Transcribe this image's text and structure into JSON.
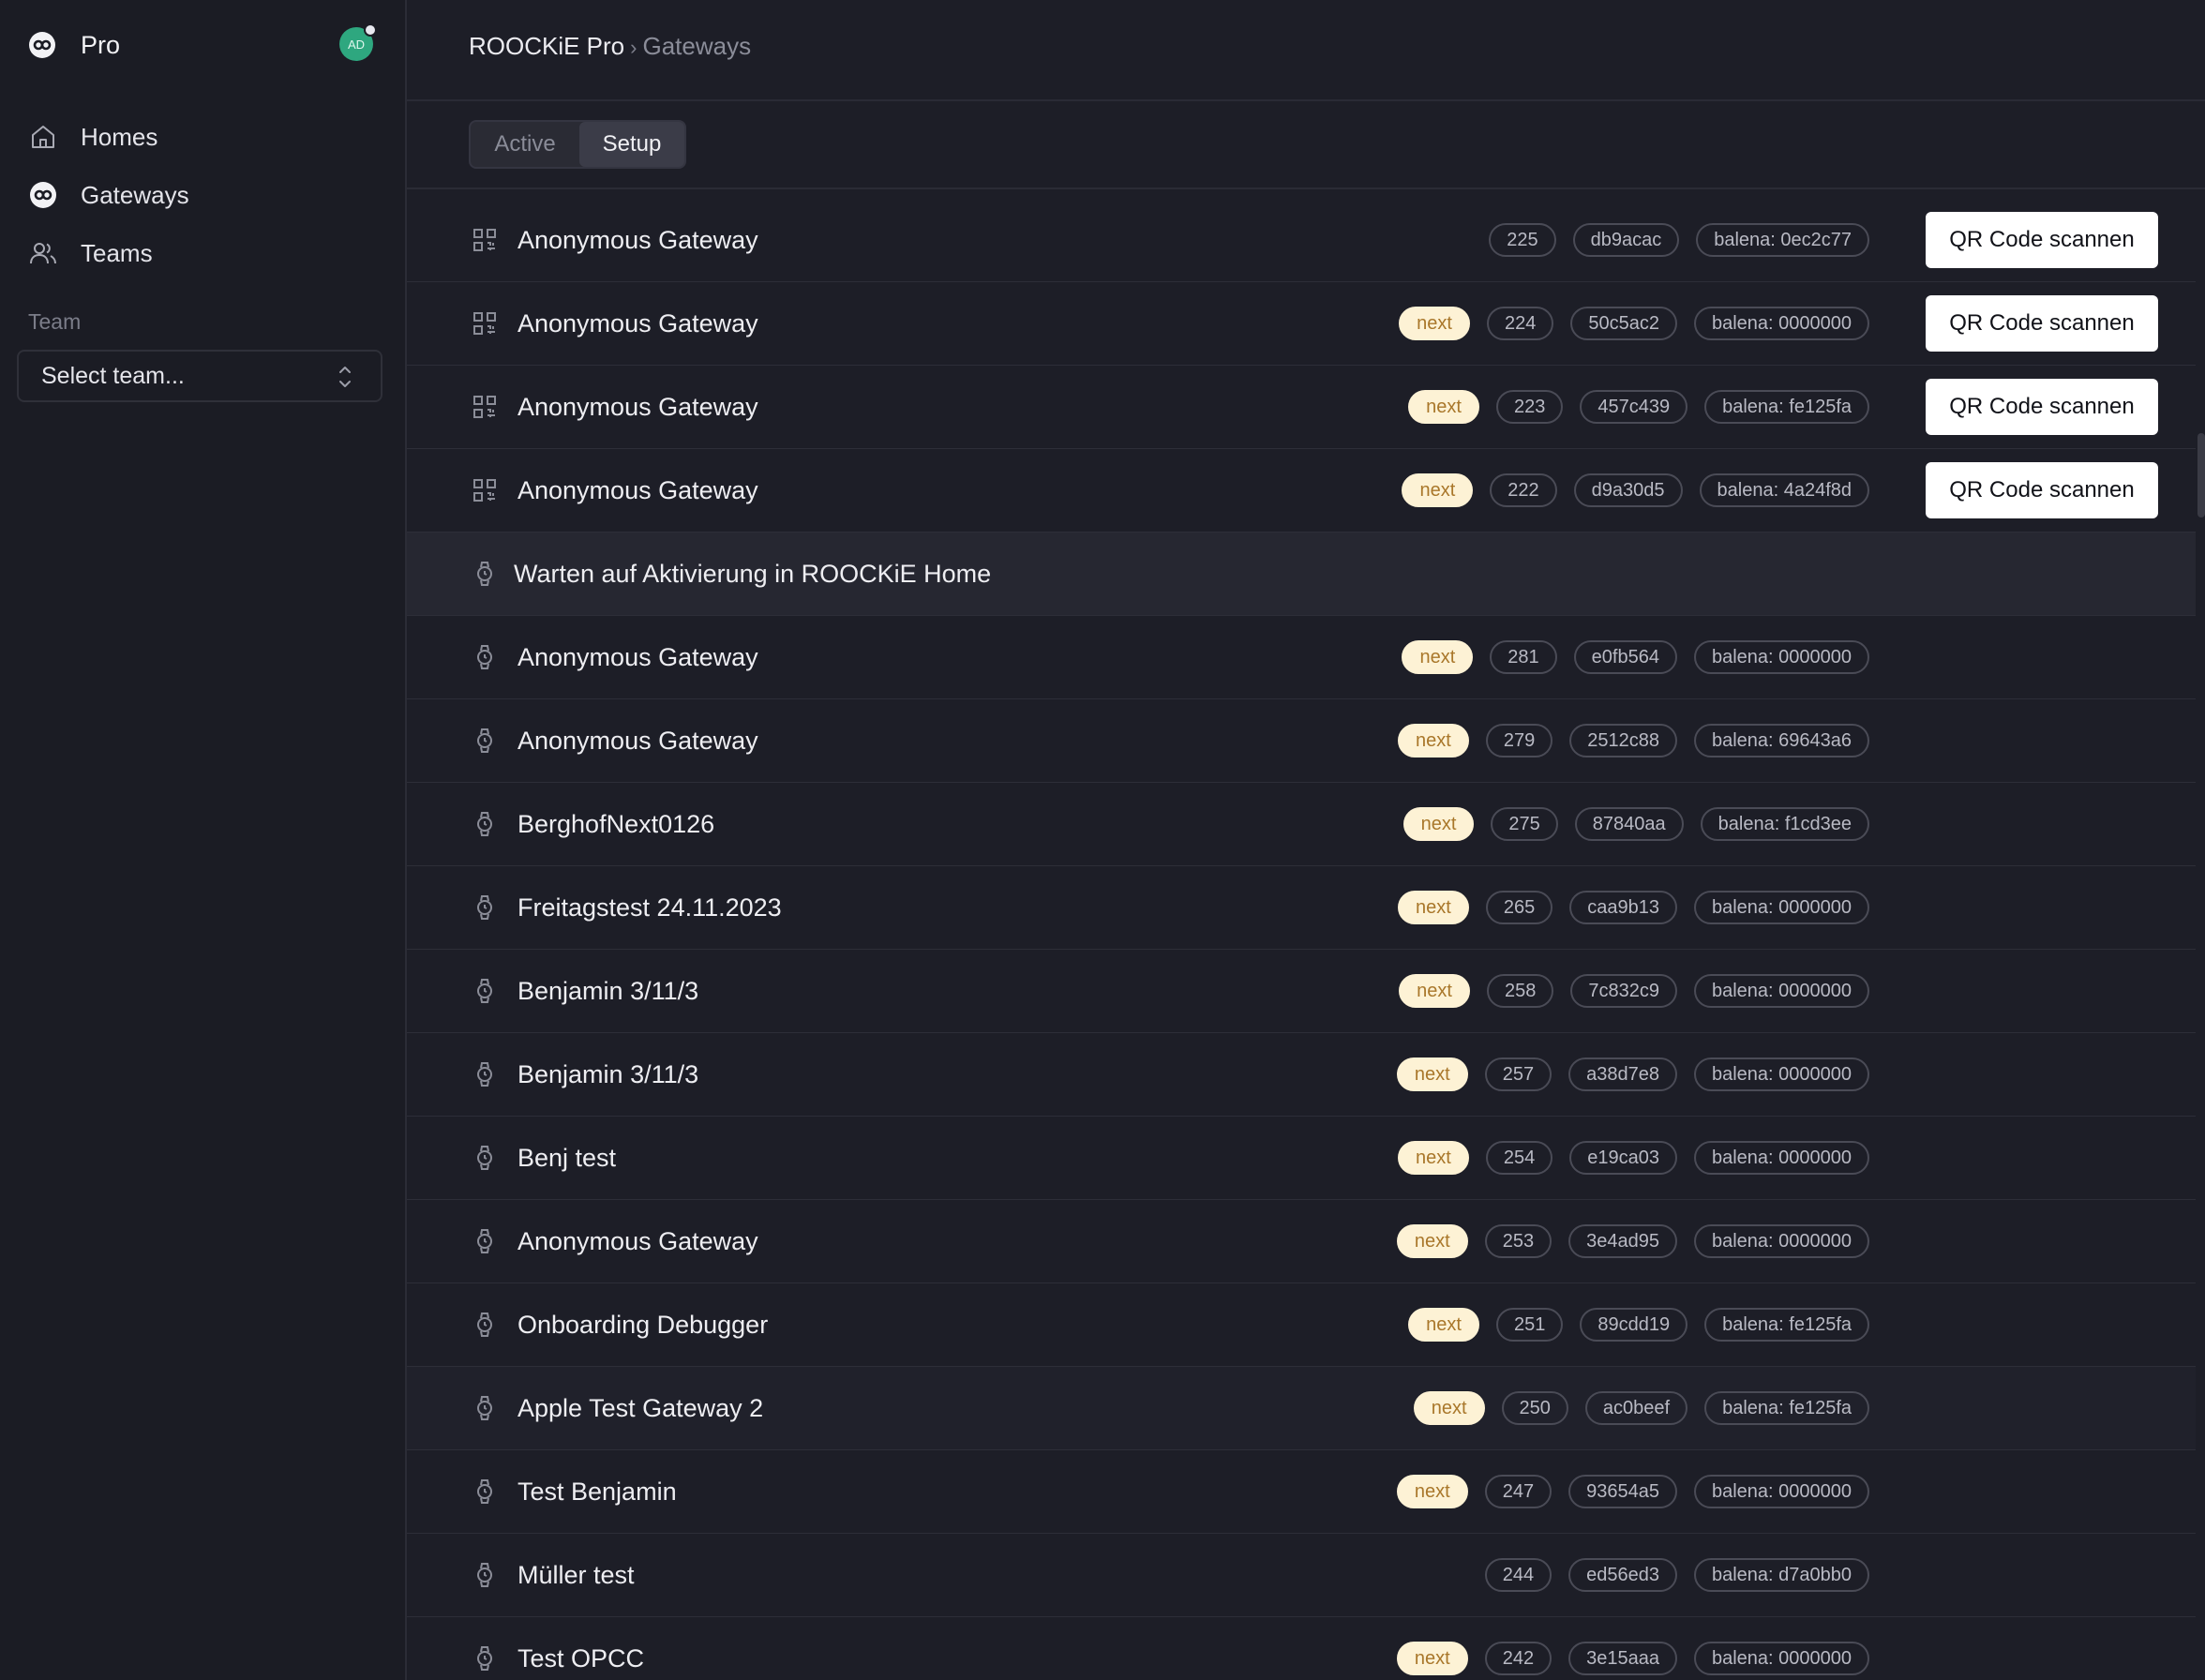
{
  "sidebar": {
    "brand": "Pro",
    "avatar_initials": "AD",
    "nav": [
      {
        "label": "Homes",
        "icon": "home-icon"
      },
      {
        "label": "Gateways",
        "icon": "infinity-icon"
      },
      {
        "label": "Teams",
        "icon": "users-icon"
      }
    ],
    "team_label": "Team",
    "team_select": "Select team..."
  },
  "header": {
    "breadcrumb_root": "ROOCKiE Pro",
    "breadcrumb_sep": "›",
    "breadcrumb_current": "Gateways"
  },
  "tabs": [
    {
      "label": "Active",
      "selected": false
    },
    {
      "label": "Setup",
      "selected": true
    }
  ],
  "colors": {
    "background": "#1d1e27",
    "next_badge_bg": "#fdf2d5",
    "next_badge_text": "#a9772a",
    "avatar": "#2ea77f"
  },
  "qr_button_label": "QR Code scannen",
  "scan_rows": [
    {
      "name": "Anonymous Gateway",
      "next": "",
      "id": "225",
      "hash": "db9acac",
      "balena": "balena: 0ec2c77"
    },
    {
      "name": "Anonymous Gateway",
      "next": "next",
      "id": "224",
      "hash": "50c5ac2",
      "balena": "balena: 0000000"
    },
    {
      "name": "Anonymous Gateway",
      "next": "next",
      "id": "223",
      "hash": "457c439",
      "balena": "balena: fe125fa"
    },
    {
      "name": "Anonymous Gateway",
      "next": "next",
      "id": "222",
      "hash": "d9a30d5",
      "balena": "balena: 4a24f8d"
    }
  ],
  "section_title": "Warten auf Aktivierung in ROOCKiE Home",
  "waiting_rows": [
    {
      "name": "Anonymous Gateway",
      "next": "next",
      "id": "281",
      "hash": "e0fb564",
      "balena": "balena: 0000000"
    },
    {
      "name": "Anonymous Gateway",
      "next": "next",
      "id": "279",
      "hash": "2512c88",
      "balena": "balena: 69643a6"
    },
    {
      "name": "BerghofNext0126",
      "next": "next",
      "id": "275",
      "hash": "87840aa",
      "balena": "balena: f1cd3ee"
    },
    {
      "name": "Freitagstest 24.11.2023",
      "next": "next",
      "id": "265",
      "hash": "caa9b13",
      "balena": "balena: 0000000"
    },
    {
      "name": "Benjamin 3/11/3",
      "next": "next",
      "id": "258",
      "hash": "7c832c9",
      "balena": "balena: 0000000"
    },
    {
      "name": "Benjamin 3/11/3",
      "next": "next",
      "id": "257",
      "hash": "a38d7e8",
      "balena": "balena: 0000000"
    },
    {
      "name": "Benj test",
      "next": "next",
      "id": "254",
      "hash": "e19ca03",
      "balena": "balena: 0000000"
    },
    {
      "name": "Anonymous Gateway",
      "next": "next",
      "id": "253",
      "hash": "3e4ad95",
      "balena": "balena: 0000000"
    },
    {
      "name": "Onboarding Debugger",
      "next": "next",
      "id": "251",
      "hash": "89cdd19",
      "balena": "balena: fe125fa"
    },
    {
      "name": "Apple Test Gateway 2",
      "next": "next",
      "id": "250",
      "hash": "ac0beef",
      "balena": "balena: fe125fa"
    },
    {
      "name": "Test Benjamin",
      "next": "next",
      "id": "247",
      "hash": "93654a5",
      "balena": "balena: 0000000"
    },
    {
      "name": "Müller test",
      "next": "",
      "id": "244",
      "hash": "ed56ed3",
      "balena": "balena: d7a0bb0"
    },
    {
      "name": "Test OPCC",
      "next": "next",
      "id": "242",
      "hash": "3e15aaa",
      "balena": "balena: 0000000"
    }
  ]
}
